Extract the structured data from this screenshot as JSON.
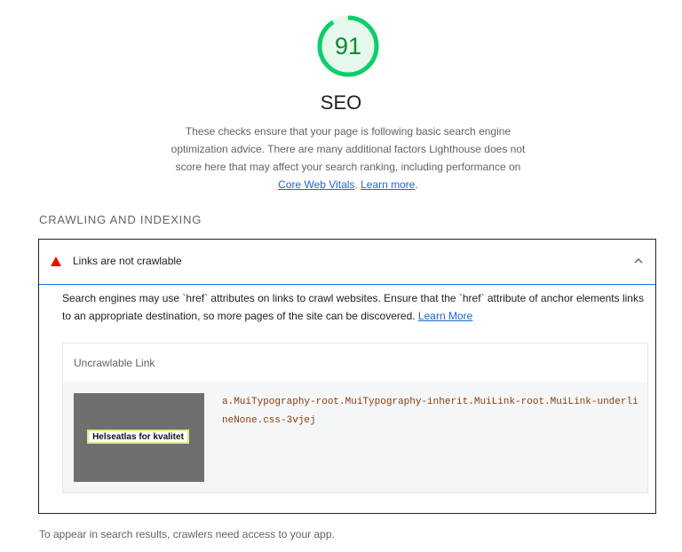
{
  "category": {
    "score": "91",
    "score_fraction": 0.91,
    "title": "SEO",
    "description_text": "These checks ensure that your page is following basic search engine optimization advice. There are many additional factors Lighthouse does not score here that may affect your search ranking, including performance on ",
    "cwv_link": "Core Web Vitals",
    "sep": ". ",
    "learn_more_link": "Learn more",
    "end": "."
  },
  "group": {
    "title": "CRAWLING AND INDEXING"
  },
  "audit": {
    "title": "Links are not crawlable",
    "description_text": "Search engines may use `href` attributes on links to crawl websites. Ensure that the `href` attribute of anchor elements links to an appropriate destination, so more pages of the site can be discovered. ",
    "learn_more_link": "Learn More",
    "table_header": "Uncrawlable Link",
    "thumbnail_text": "Helseatlas for kvalitet",
    "selector": "a.MuiTypography-root.MuiTypography-inherit.MuiLink-root.MuiLink-underlineNone.css-3vjej"
  },
  "footer_note": "To appear in search results, crawlers need access to your app.",
  "colors": {
    "pass_green": "#0cce6b",
    "fail_red": "#eb0f00",
    "link_blue": "#1a66d8"
  },
  "icons": {
    "fail": "triangle-icon",
    "collapse": "chevron-up-icon"
  }
}
